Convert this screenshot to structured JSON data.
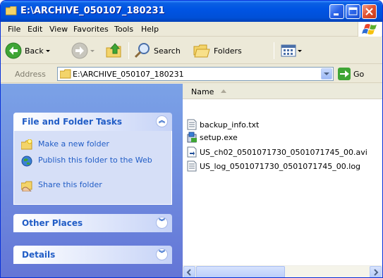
{
  "window": {
    "title": "E:\\ARCHIVE_050107_180231"
  },
  "menu": {
    "items": [
      {
        "label": "File"
      },
      {
        "label": "Edit"
      },
      {
        "label": "View"
      },
      {
        "label": "Favorites"
      },
      {
        "label": "Tools"
      },
      {
        "label": "Help"
      }
    ]
  },
  "toolbar": {
    "back_label": "Back",
    "search_label": "Search",
    "folders_label": "Folders"
  },
  "address": {
    "label": "Address",
    "value": "E:\\ARCHIVE_050107_180231",
    "go_label": "Go"
  },
  "taskpane": {
    "file_folder_tasks": {
      "title": "File and Folder Tasks",
      "tasks": [
        {
          "label": "Make a new folder",
          "icon": "new-folder-icon"
        },
        {
          "label": "Publish this folder to the Web",
          "icon": "publish-web-icon"
        },
        {
          "label": "Share this folder",
          "icon": "share-folder-icon"
        }
      ]
    },
    "other_places": {
      "title": "Other Places"
    },
    "details": {
      "title": "Details"
    }
  },
  "filelist": {
    "column_name": "Name",
    "files": [
      {
        "name": "backup_info.txt",
        "icon": "text-file-icon"
      },
      {
        "name": "setup.exe",
        "icon": "setup-exe-icon"
      },
      {
        "name": "US_ch02_0501071730_0501071745_00.avi",
        "icon": "video-file-icon"
      },
      {
        "name": "US_log_0501071730_0501071745_00.log",
        "icon": "log-file-icon"
      }
    ]
  },
  "colors": {
    "titlebar": "#0054e3",
    "taskpane_bg": "#7ba2e7",
    "task_link": "#215dc6",
    "chrome": "#ece9d8"
  }
}
